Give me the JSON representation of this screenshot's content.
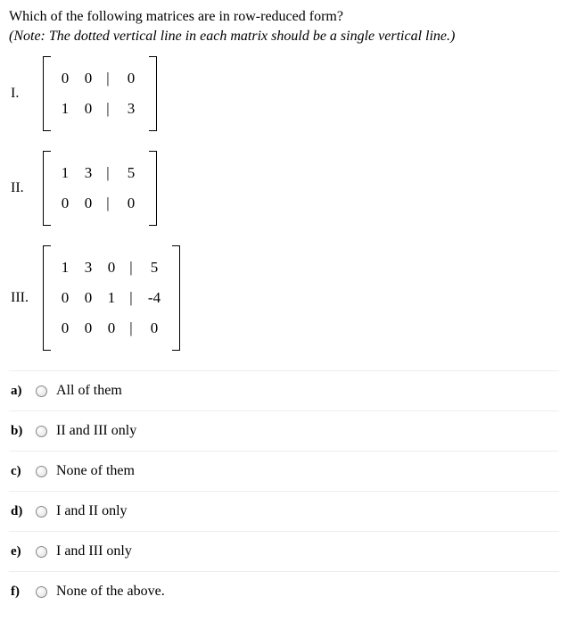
{
  "question": {
    "prompt": "Which of the following matrices are in row-reduced form?",
    "note": "(Note: The dotted vertical line in each matrix should be a single vertical line.)"
  },
  "matrices": [
    {
      "label": "I.",
      "rows": [
        {
          "cells": [
            "0",
            "0"
          ],
          "aug": "0"
        },
        {
          "cells": [
            "1",
            "0"
          ],
          "aug": "3"
        }
      ]
    },
    {
      "label": "II.",
      "rows": [
        {
          "cells": [
            "1",
            "3"
          ],
          "aug": "5"
        },
        {
          "cells": [
            "0",
            "0"
          ],
          "aug": "0"
        }
      ]
    },
    {
      "label": "III.",
      "rows": [
        {
          "cells": [
            "1",
            "3",
            "0"
          ],
          "aug": "5"
        },
        {
          "cells": [
            "0",
            "0",
            "1"
          ],
          "aug": "-4"
        },
        {
          "cells": [
            "0",
            "0",
            "0"
          ],
          "aug": "0"
        }
      ]
    }
  ],
  "separator": "|",
  "options": [
    {
      "label": "a)",
      "text": "All of them"
    },
    {
      "label": "b)",
      "text": "II and III only"
    },
    {
      "label": "c)",
      "text": "None of them"
    },
    {
      "label": "d)",
      "text": "I and II only"
    },
    {
      "label": "e)",
      "text": "I and III only"
    },
    {
      "label": "f)",
      "text": "None of the above."
    }
  ]
}
